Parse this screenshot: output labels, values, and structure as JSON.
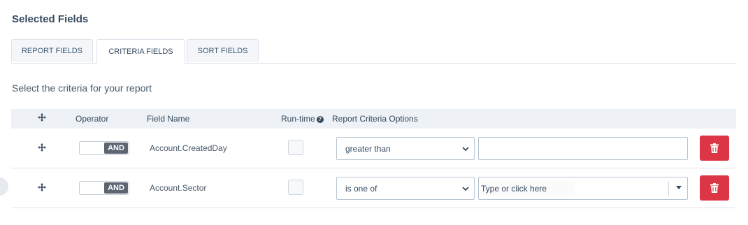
{
  "section_title": "Selected Fields",
  "tabs": [
    {
      "label": "REPORT FIELDS",
      "active": false
    },
    {
      "label": "CRITERIA FIELDS",
      "active": true
    },
    {
      "label": "SORT FIELDS",
      "active": false
    }
  ],
  "subtitle": "Select the criteria for your report",
  "grid": {
    "headers": {
      "operator": "Operator",
      "field_name": "Field Name",
      "run_time": "Run-time",
      "options": "Report Criteria Options"
    },
    "rows": [
      {
        "operator": "AND",
        "field_name": "Account.CreatedDay",
        "run_time_checked": false,
        "criteria": "greater than",
        "value": ""
      },
      {
        "operator": "AND",
        "field_name": "Account.Sector",
        "run_time_checked": false,
        "criteria": "is one of",
        "value_placeholder": "Type or click here"
      }
    ]
  },
  "colors": {
    "accent_text": "#34495e",
    "delete_button": "#dc3545",
    "header_bg": "#eef1f5",
    "toggle_knob": "#5b6670"
  },
  "icons": {
    "move": "move-arrows-icon",
    "help": "question-circle-icon",
    "chevron": "chevron-down-icon",
    "delete": "trash-icon"
  }
}
